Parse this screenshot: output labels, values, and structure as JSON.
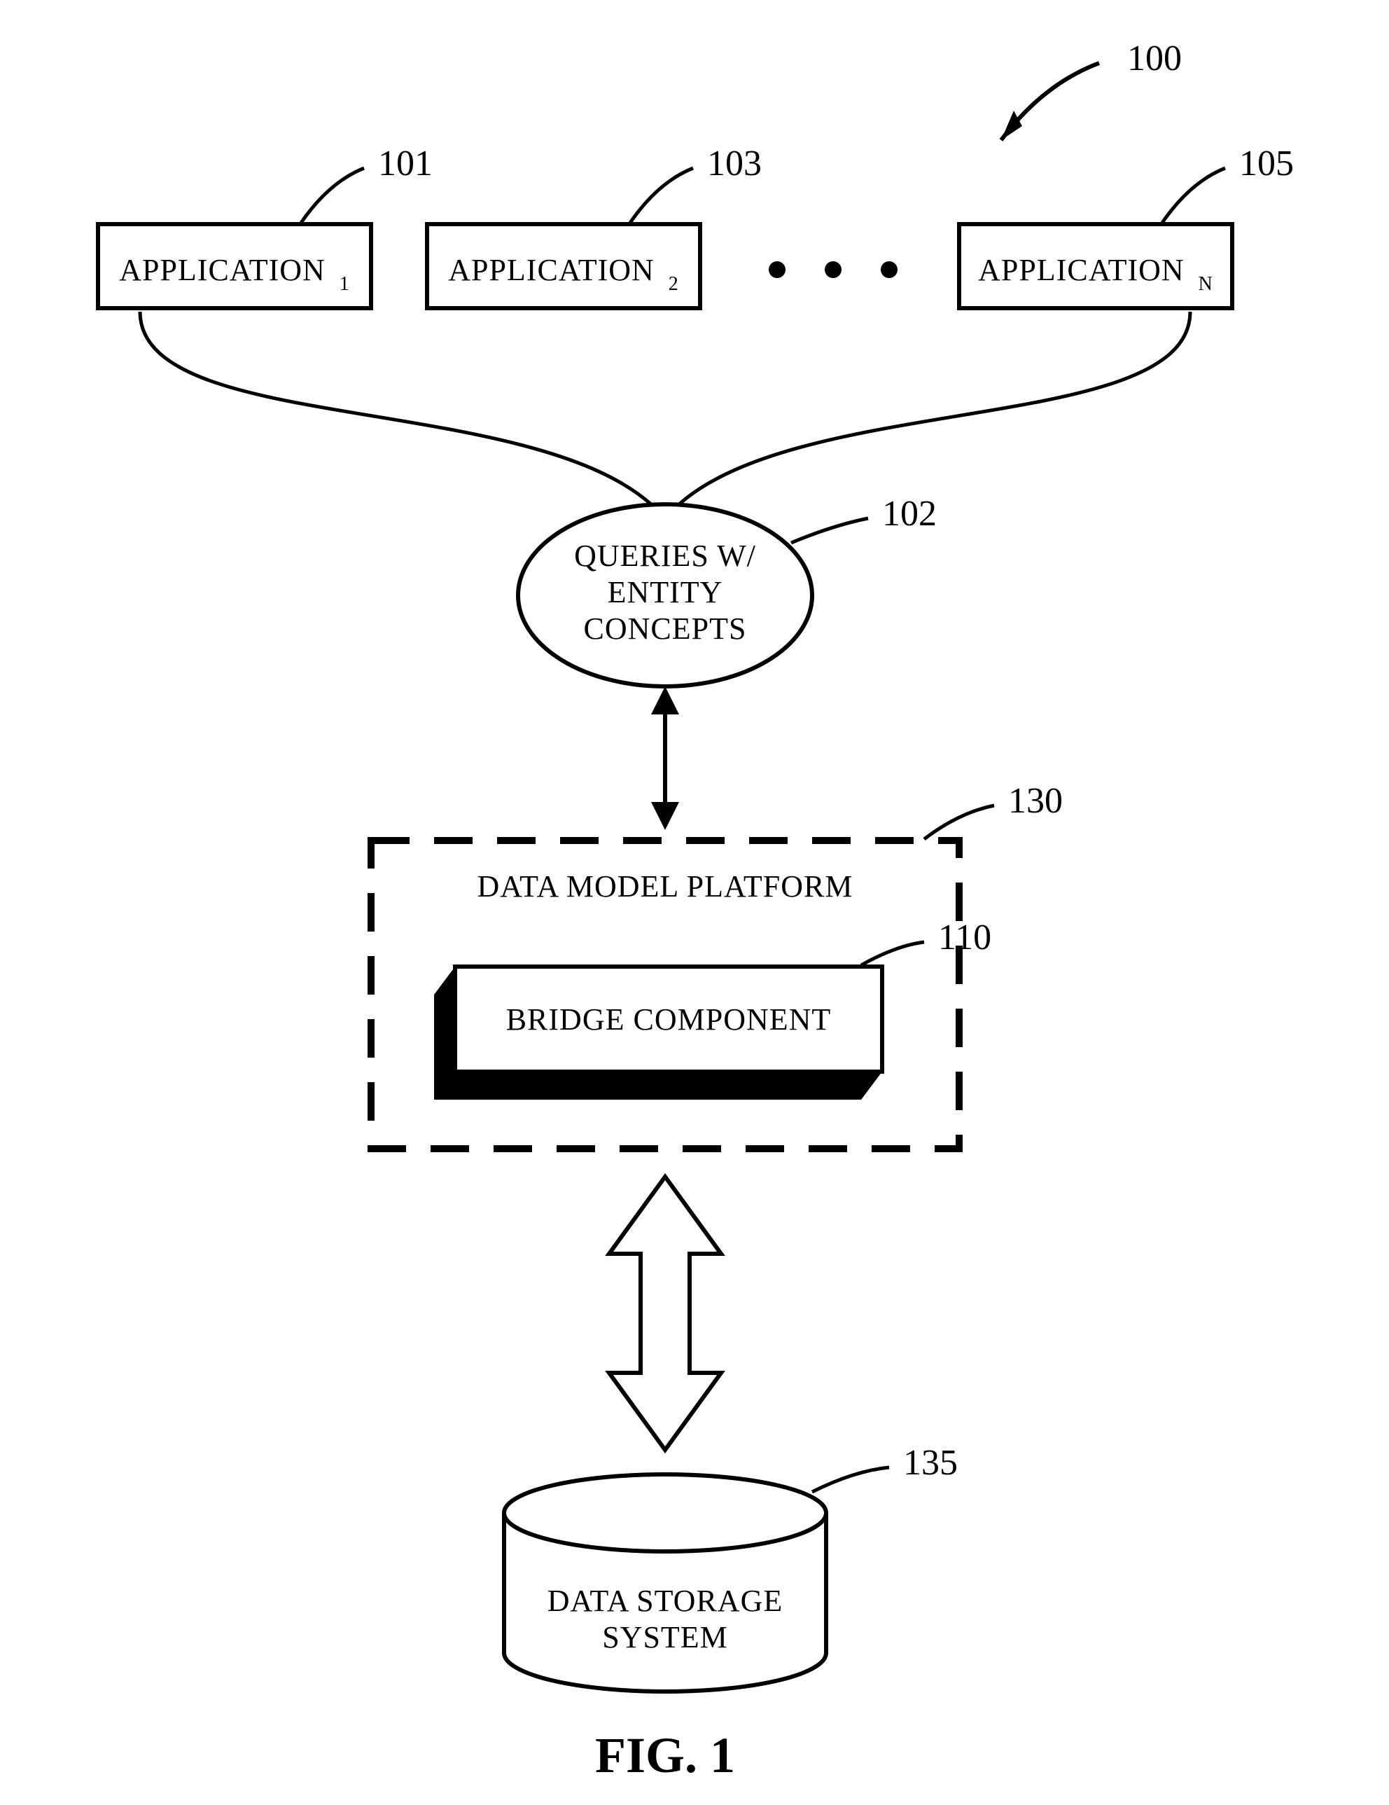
{
  "refs": {
    "system": "100",
    "app1": "101",
    "app2": "103",
    "appN": "105",
    "queries": "102",
    "platform": "130",
    "bridge": "110",
    "storage": "135"
  },
  "labels": {
    "app_base": "APPLICATION",
    "app1_sub": "1",
    "app2_sub": "2",
    "appN_sub": "N",
    "queries_line1": "QUERIES W/",
    "queries_line2": "ENTITY",
    "queries_line3": "CONCEPTS",
    "platform": "DATA MODEL PLATFORM",
    "bridge": "BRIDGE  COMPONENT",
    "storage_line1": "DATA STORAGE",
    "storage_line2": "SYSTEM"
  },
  "figure_label": "FIG. 1"
}
